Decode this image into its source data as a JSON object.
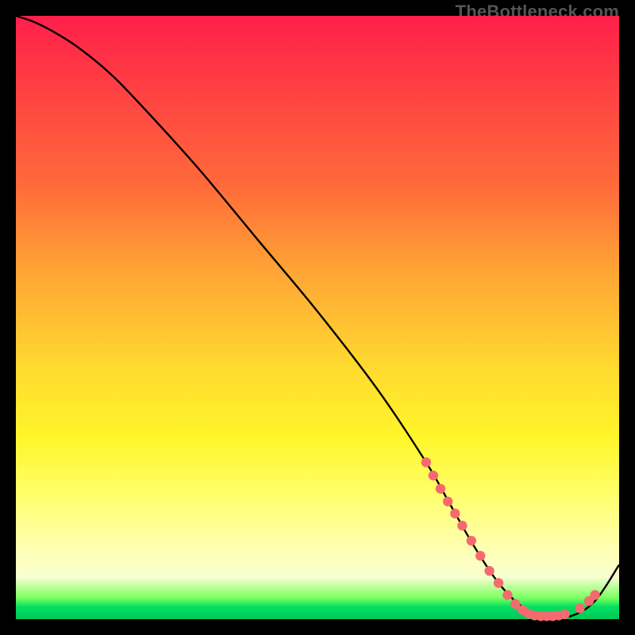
{
  "watermark": "TheBottleneck.com",
  "colors": {
    "frame": "#000000",
    "curve": "#000000",
    "dot_fill": "#f46a6f",
    "dot_stroke": "#e85a60"
  },
  "chart_data": {
    "type": "line",
    "title": "",
    "xlabel": "",
    "ylabel": "",
    "xlim": [
      0,
      100
    ],
    "ylim": [
      0,
      100
    ],
    "grid": false,
    "legend": false,
    "series": [
      {
        "name": "curve",
        "x": [
          0,
          3,
          6,
          10,
          15,
          20,
          30,
          40,
          50,
          60,
          68,
          72,
          76,
          80,
          84,
          88,
          92,
          96,
          100
        ],
        "y": [
          100,
          99,
          97.5,
          95,
          91,
          86,
          75,
          63,
          51,
          38,
          26,
          19,
          12,
          6,
          2,
          0.5,
          0.5,
          3,
          9
        ]
      }
    ],
    "markers": [
      {
        "x": 68.0,
        "y": 26.0
      },
      {
        "x": 69.2,
        "y": 23.8
      },
      {
        "x": 70.4,
        "y": 21.6
      },
      {
        "x": 71.6,
        "y": 19.5
      },
      {
        "x": 72.8,
        "y": 17.5
      },
      {
        "x": 74.0,
        "y": 15.5
      },
      {
        "x": 75.5,
        "y": 13.0
      },
      {
        "x": 77.0,
        "y": 10.5
      },
      {
        "x": 78.5,
        "y": 8.0
      },
      {
        "x": 80.0,
        "y": 6.0
      },
      {
        "x": 81.5,
        "y": 4.0
      },
      {
        "x": 82.8,
        "y": 2.5
      },
      {
        "x": 84.0,
        "y": 1.5
      },
      {
        "x": 85.0,
        "y": 0.9
      },
      {
        "x": 86.0,
        "y": 0.6
      },
      {
        "x": 87.0,
        "y": 0.5
      },
      {
        "x": 88.0,
        "y": 0.5
      },
      {
        "x": 89.0,
        "y": 0.5
      },
      {
        "x": 90.0,
        "y": 0.6
      },
      {
        "x": 91.0,
        "y": 0.8
      },
      {
        "x": 93.5,
        "y": 1.8
      },
      {
        "x": 95.0,
        "y": 3.0
      },
      {
        "x": 96.0,
        "y": 4.0
      }
    ]
  }
}
